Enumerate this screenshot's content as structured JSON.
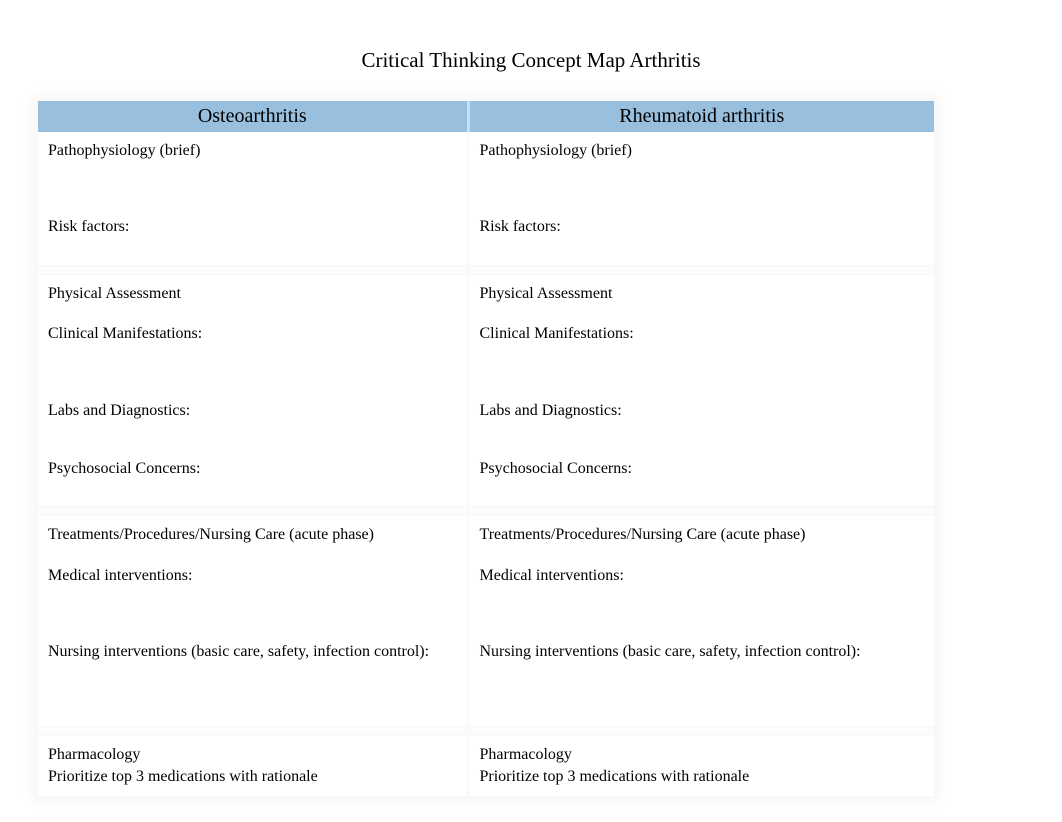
{
  "title": "Critical Thinking Concept Map Arthritis",
  "columns": {
    "left": {
      "header": "Osteoarthritis"
    },
    "right": {
      "header": "Rheumatoid arthritis"
    }
  },
  "sections": {
    "patho": {
      "heading": "Pathophysiology (brief)",
      "risk": "Risk factors:"
    },
    "assessment": {
      "heading": "Physical Assessment",
      "manifest": "Clinical Manifestations:",
      "labs": "Labs and Diagnostics:",
      "psych": "Psychosocial Concerns:"
    },
    "treatments": {
      "heading": "Treatments/Procedures/Nursing Care (acute phase)",
      "medical": "Medical interventions:",
      "nursing": "Nursing interventions (basic care, safety, infection control):"
    },
    "pharm": {
      "heading": "Pharmacology",
      "prioritize": "Prioritize top 3 medications with rationale"
    }
  }
}
